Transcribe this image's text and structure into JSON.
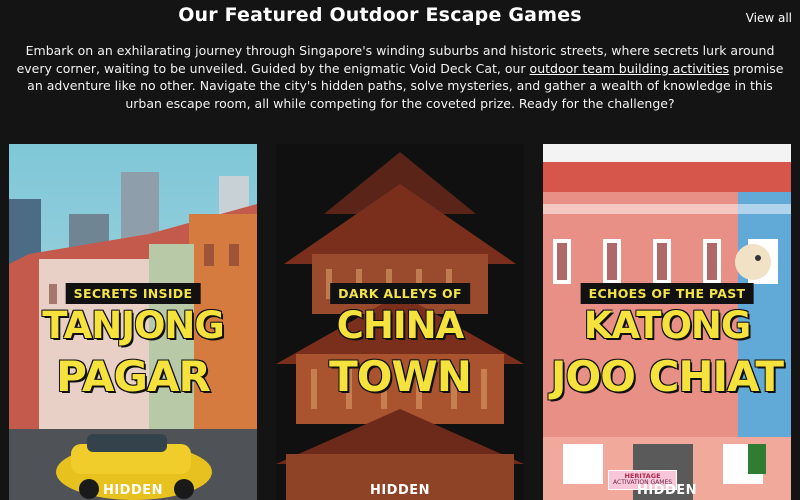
{
  "header": {
    "title": "Our Featured Outdoor Escape Games",
    "view_all": "View all"
  },
  "intro": {
    "text_before": "Embark on an exhilarating journey through Singapore's winding suburbs and historic streets, where secrets lurk around every corner, waiting to be unveiled. Guided by the enigmatic Void Deck Cat, our ",
    "link_text": "outdoor team building activities",
    "text_after": " promise an adventure like no other. Navigate the city's hidden paths, solve mysteries, and gather a wealth of knowledge in this urban escape room, all while competing for the coveted prize. Ready for the challenge?"
  },
  "cards": [
    {
      "tagline": "SECRETS INSIDE",
      "line1": "TANJONG",
      "line2": "PAGAR",
      "brand": "HIDDEN"
    },
    {
      "tagline": "DARK ALLEYS OF",
      "line1": "CHINA",
      "line2": "TOWN",
      "brand": "HIDDEN"
    },
    {
      "tagline": "ECHOES OF THE PAST",
      "line1": "KATONG",
      "line2": "JOO CHIAT",
      "brand": "HIDDEN",
      "badge_line1": "HERITAGE",
      "badge_line2": "ACTIVATION GAMES"
    }
  ],
  "colors": {
    "background": "#141414",
    "title_yellow": "#f6e23c",
    "tag_bg": "#111111"
  }
}
